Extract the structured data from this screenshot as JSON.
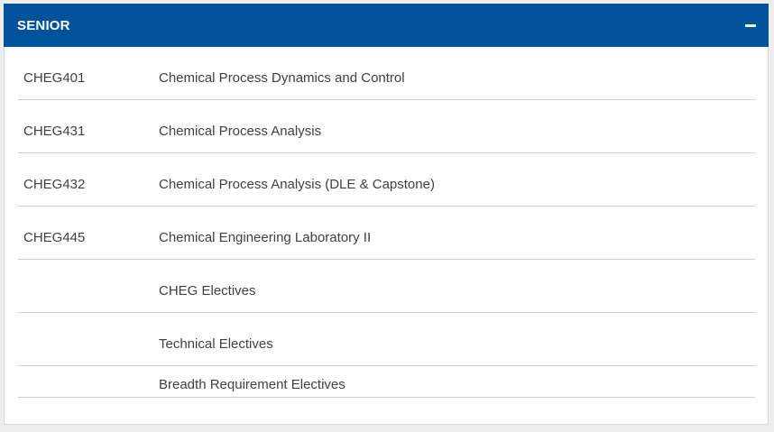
{
  "section": {
    "title": "SENIOR",
    "toggle_icon": "minus-icon"
  },
  "courses": [
    {
      "code": "CHEG401",
      "name": "Chemical Process Dynamics and Control"
    },
    {
      "code": "CHEG431",
      "name": "Chemical Process Analysis"
    },
    {
      "code": "CHEG432",
      "name": "Chemical Process Analysis (DLE & Capstone)"
    },
    {
      "code": "CHEG445",
      "name": "Chemical Engineering Laboratory II"
    },
    {
      "code": "",
      "name": "CHEG Electives"
    },
    {
      "code": "",
      "name": "Technical Electives"
    },
    {
      "code": "",
      "name": "Breadth Requirement Electives"
    }
  ],
  "colors": {
    "header_bg": "#00529b",
    "header_text": "#ffffff",
    "body_text": "#404040",
    "divider": "#cfcfcf"
  }
}
